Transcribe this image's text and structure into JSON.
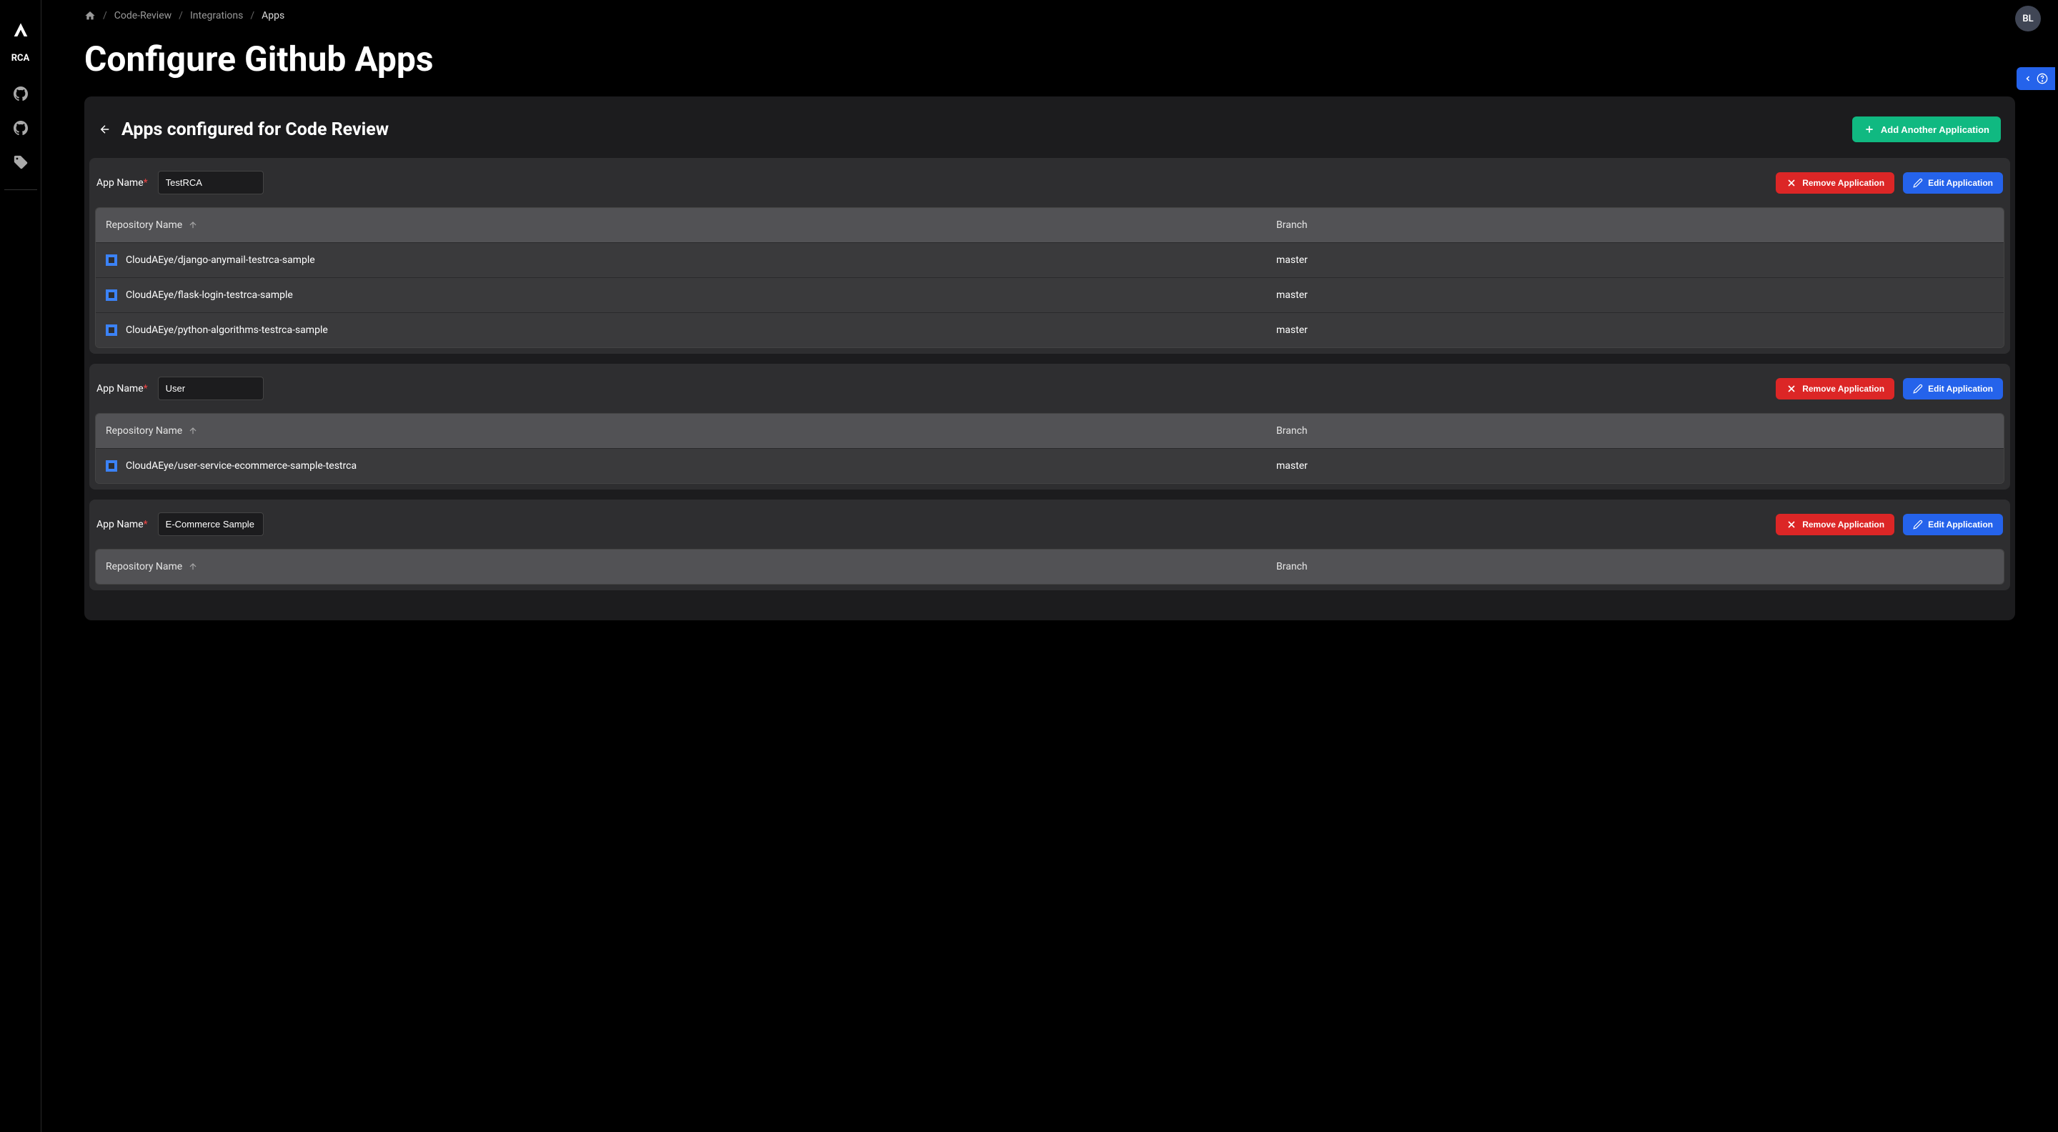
{
  "sidebar": {
    "label": "RCA"
  },
  "avatar": "BL",
  "breadcrumbs": {
    "home": "home",
    "items": [
      "Code-Review",
      "Integrations"
    ],
    "current": "Apps"
  },
  "page_title": "Configure Github Apps",
  "card": {
    "title": "Apps configured for Code Review",
    "add_btn": "Add Another Application"
  },
  "labels": {
    "app_name": "App Name",
    "remove": "Remove Application",
    "edit": "Edit Application",
    "repo_col": "Repository Name",
    "branch_col": "Branch"
  },
  "apps": [
    {
      "name": "TestRCA",
      "repos": [
        {
          "name": "CloudAEye/django-anymail-testrca-sample",
          "branch": "master"
        },
        {
          "name": "CloudAEye/flask-login-testrca-sample",
          "branch": "master"
        },
        {
          "name": "CloudAEye/python-algorithms-testrca-sample",
          "branch": "master"
        }
      ]
    },
    {
      "name": "User",
      "repos": [
        {
          "name": "CloudAEye/user-service-ecommerce-sample-testrca",
          "branch": "master"
        }
      ]
    },
    {
      "name": "E-Commerce Sample",
      "repos": []
    }
  ]
}
